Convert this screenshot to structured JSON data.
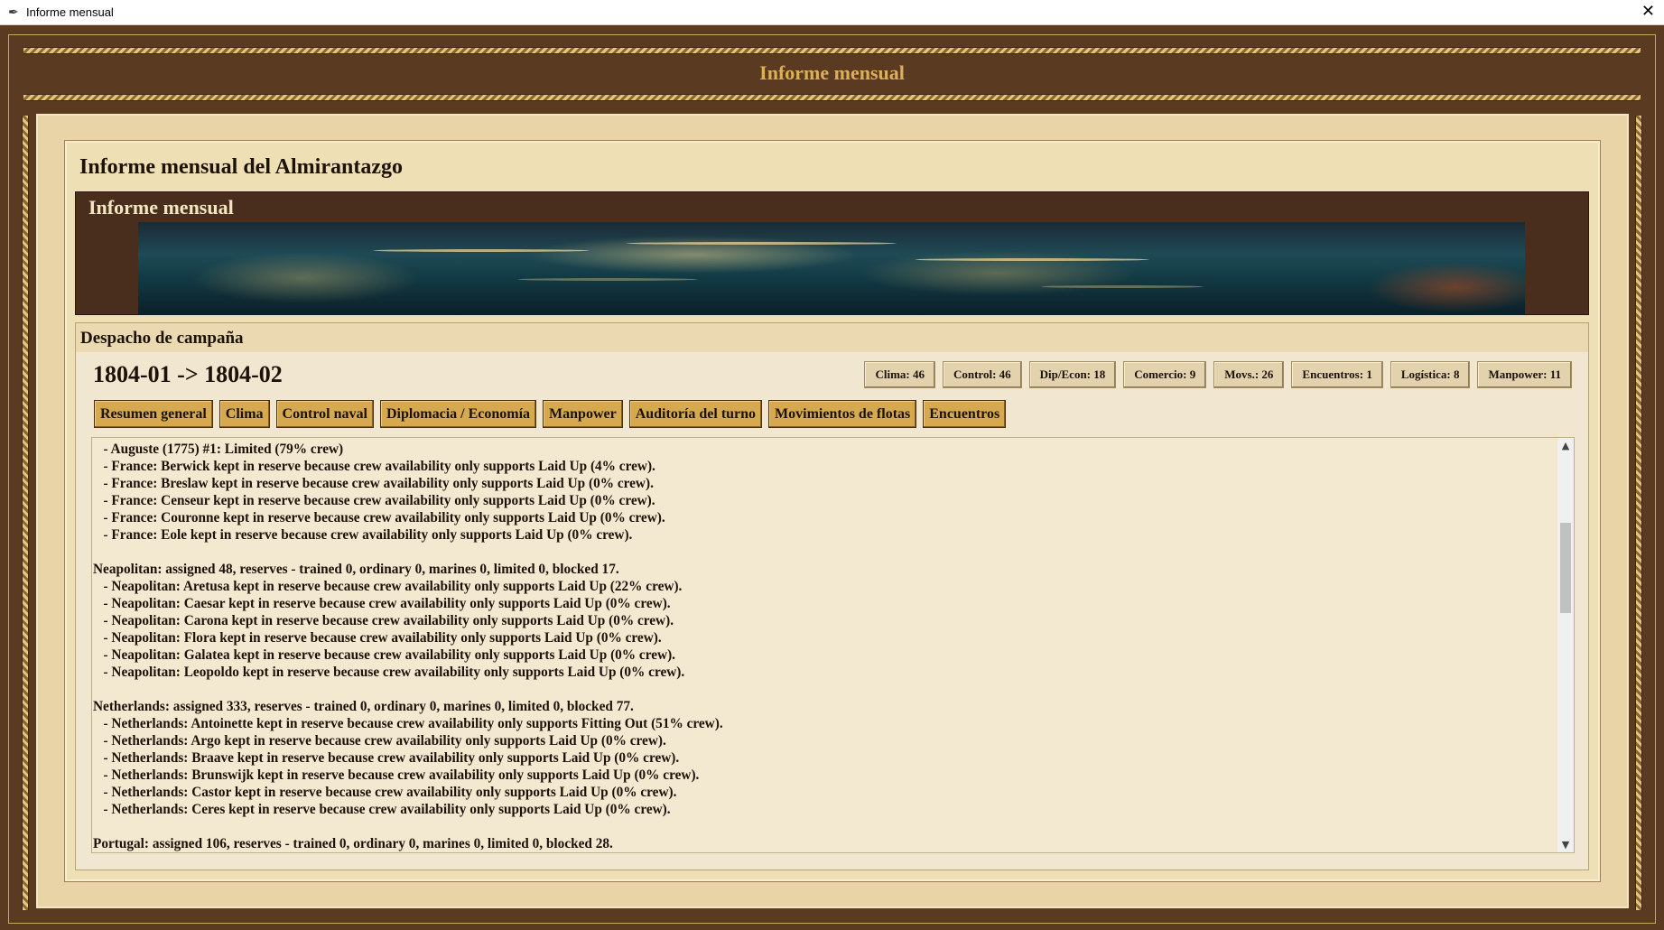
{
  "window": {
    "title": "Informe mensual",
    "close_glyph": "✕",
    "icon": "feather-icon"
  },
  "header": {
    "title": "Informe mensual"
  },
  "panel": {
    "title": "Informe mensual del Almirantazgo"
  },
  "banner": {
    "title": "Informe mensual"
  },
  "dispatch": {
    "title": "Despacho de campaña",
    "period": "1804-01 -> 1804-02",
    "stats": [
      "Clima: 46",
      "Control: 46",
      "Dip/Econ: 18",
      "Comercio: 9",
      "Movs.: 26",
      "Encuentros: 1",
      "Logística: 8",
      "Manpower: 11"
    ],
    "tabs": [
      "Resumen general",
      "Clima",
      "Control naval",
      "Diplomacia / Economía",
      "Manpower",
      "Auditoría del turno",
      "Movimientos de flotas",
      "Encuentros"
    ]
  },
  "log": {
    "lines": [
      "   - Auguste (1775) #1: Limited (79% crew)",
      "   - France: Berwick kept in reserve because crew availability only supports Laid Up (4% crew).",
      "   - France: Breslaw kept in reserve because crew availability only supports Laid Up (0% crew).",
      "   - France: Censeur kept in reserve because crew availability only supports Laid Up (0% crew).",
      "   - France: Couronne kept in reserve because crew availability only supports Laid Up (0% crew).",
      "   - France: Eole kept in reserve because crew availability only supports Laid Up (0% crew).",
      "",
      "Neapolitan: assigned 48, reserves - trained 0, ordinary 0, marines 0, limited 0, blocked 17.",
      "   - Neapolitan: Aretusa kept in reserve because crew availability only supports Laid Up (22% crew).",
      "   - Neapolitan: Caesar kept in reserve because crew availability only supports Laid Up (0% crew).",
      "   - Neapolitan: Carona kept in reserve because crew availability only supports Laid Up (0% crew).",
      "   - Neapolitan: Flora kept in reserve because crew availability only supports Laid Up (0% crew).",
      "   - Neapolitan: Galatea kept in reserve because crew availability only supports Laid Up (0% crew).",
      "   - Neapolitan: Leopoldo kept in reserve because crew availability only supports Laid Up (0% crew).",
      "",
      "Netherlands: assigned 333, reserves - trained 0, ordinary 0, marines 0, limited 0, blocked 77.",
      "   - Netherlands: Antoinette kept in reserve because crew availability only supports Fitting Out (51% crew).",
      "   - Netherlands: Argo kept in reserve because crew availability only supports Laid Up (0% crew).",
      "   - Netherlands: Braave kept in reserve because crew availability only supports Laid Up (0% crew).",
      "   - Netherlands: Brunswijk kept in reserve because crew availability only supports Laid Up (0% crew).",
      "   - Netherlands: Castor kept in reserve because crew availability only supports Laid Up (0% crew).",
      "   - Netherlands: Ceres kept in reserve because crew availability only supports Laid Up (0% crew).",
      "",
      "Portugal: assigned 106, reserves - trained 0, ordinary 0, marines 0, limited 0, blocked 28."
    ],
    "scroll_position": 0.22
  }
}
